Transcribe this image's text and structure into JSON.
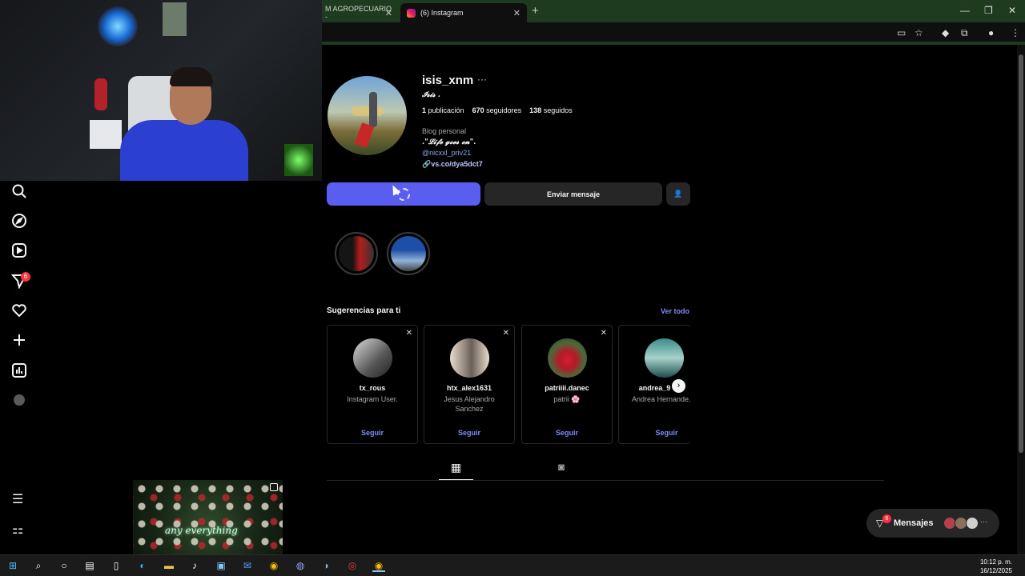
{
  "browser": {
    "tabs": [
      {
        "label": "M AGROPECUARIO -",
        "close": "✕"
      },
      {
        "label": "(6) Instagram",
        "close": "✕"
      }
    ],
    "new_tab": "+",
    "window_controls": [
      "—",
      "❐",
      "✕"
    ]
  },
  "sidebar": {
    "notifications_badge": "6"
  },
  "profile": {
    "username": "isis_xnm",
    "more": "···",
    "full_name": "𝓘𝓼𝓲𝓼 .",
    "stats": {
      "posts_count": "1",
      "posts_label": "publicación",
      "followers_count": "670",
      "followers_label": "seguidores",
      "following_count": "138",
      "following_label": "seguidos"
    },
    "category": "Blog personal",
    "bio_quote": ".\"𝓛𝓲𝓯𝓮 𝓰𝓸𝓮𝓼 𝓸𝓷\".",
    "bio_mention": "@nicxxl_priv21",
    "bio_link": "vs.co/dya5dct7",
    "message_button": "Enviar mensaje"
  },
  "suggestions": {
    "title": "Sugerencias para ti",
    "see_all": "Ver todo",
    "cards": [
      {
        "username": "tx_rous",
        "subtitle": "Instagram User.",
        "follow": "Seguir",
        "close": "✕"
      },
      {
        "username": "htx_alex1631",
        "subtitle": "Jesus Alejandro Sanchez",
        "follow": "Seguir",
        "close": "✕"
      },
      {
        "username": "patriiii.danec",
        "subtitle": "patrii 🌸",
        "follow": "Seguir",
        "close": "✕"
      },
      {
        "username": "andrea_9",
        "subtitle": "Andrea Hernande.",
        "follow": "Seguir",
        "close": ""
      }
    ]
  },
  "post": {
    "caption_overlay": "any everything"
  },
  "messages": {
    "label": "Mensajes",
    "badge": "6",
    "more": "···"
  },
  "taskbar": {
    "time": "10:12 p. m.",
    "date": "16/12/2025"
  },
  "colors": {
    "follow_button": "#5a5ef0",
    "link_blue": "#7e8cf5",
    "badge_red": "#ff3040",
    "chrome_green": "#1f3b1f"
  }
}
